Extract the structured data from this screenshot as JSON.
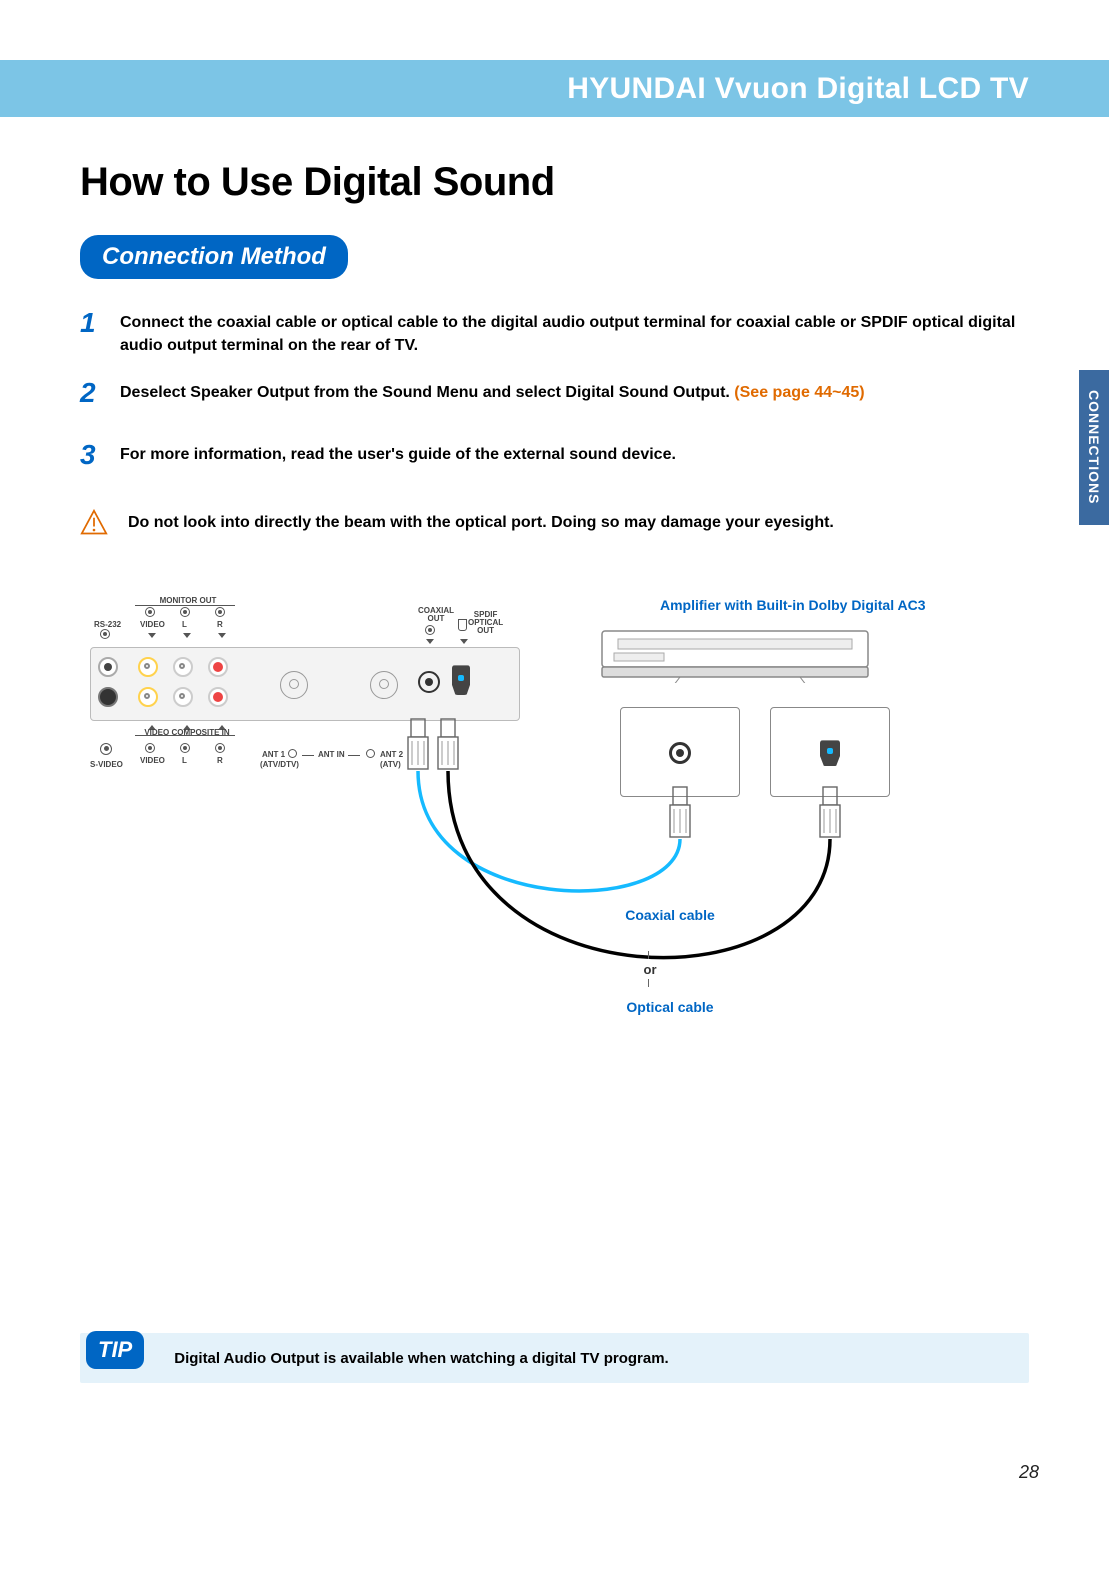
{
  "header": {
    "product_line": "HYUNDAI Vvuon Digital LCD TV"
  },
  "side_tab": "CONNECTIONS",
  "title": "How to Use Digital Sound",
  "section": "Connection Method",
  "steps": [
    {
      "num": "1",
      "text": "Connect the coaxial cable or optical cable to the digital audio output terminal for coaxial cable or SPDIF optical digital audio output terminal on the rear of TV."
    },
    {
      "num": "2",
      "text": "Deselect Speaker Output from the Sound Menu and select Digital Sound Output.",
      "ref": "(See page 44~45)"
    },
    {
      "num": "3",
      "text": "For more information, read the user's guide of the external sound device."
    }
  ],
  "warning": "Do not look into directly the beam with the optical port. Doing so may damage your eyesight.",
  "diagram": {
    "tv_ports": {
      "monitor_out": "MONITOR OUT",
      "rs232": "RS-232",
      "video": "VIDEO",
      "l": "L",
      "r": "R",
      "video_composite_in": "VIDEO COMPOSITE IN",
      "s_video": "S-VIDEO",
      "ant1": "ANT 1",
      "ant1_sub": "(ATV/DTV)",
      "ant_in": "ANT IN",
      "ant2": "ANT 2",
      "ant2_sub": "(ATV)",
      "coaxial_out": "COAXIAL\nOUT",
      "spdif_optical_out": "SPDIF\nOPTICAL\nOUT"
    },
    "amp_label": "Amplifier with Built-in Dolby Digital AC3",
    "coaxial_cable": "Coaxial cable",
    "optical_cable": "Optical cable",
    "or": "or"
  },
  "tip": {
    "badge": "TIP",
    "text": "Digital Audio Output is available when watching a digital TV program."
  },
  "page_number": "28"
}
